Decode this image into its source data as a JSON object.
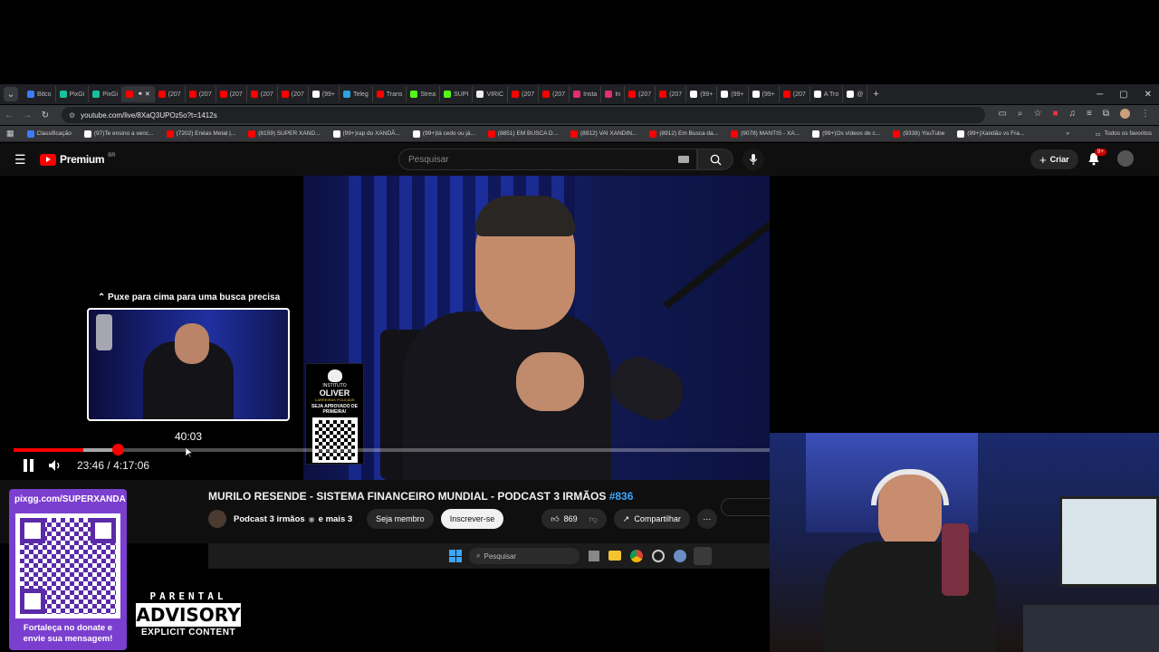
{
  "browser": {
    "tabs": [
      {
        "label": "Bitco",
        "color": "#3d7bfd"
      },
      {
        "label": "PixGi",
        "color": "#19c0a0"
      },
      {
        "label": "PixGi",
        "color": "#19c0a0"
      },
      {
        "label": "",
        "color": "#ff0000",
        "active": true
      },
      {
        "label": "(207",
        "color": "#ff0000"
      },
      {
        "label": "(207",
        "color": "#ff0000"
      },
      {
        "label": "(207",
        "color": "#ff0000"
      },
      {
        "label": "(207",
        "color": "#ff0000"
      },
      {
        "label": "(207",
        "color": "#ff0000"
      },
      {
        "label": "(99+",
        "color": "#ffffff"
      },
      {
        "label": "Teleg",
        "color": "#2aa3e0"
      },
      {
        "label": "Trans",
        "color": "#ff0000"
      },
      {
        "label": "Strea",
        "color": "#53fc18"
      },
      {
        "label": "SUPI",
        "color": "#53fc18"
      },
      {
        "label": "VIRIC",
        "color": "#eeeeee"
      },
      {
        "label": "(207",
        "color": "#ff0000"
      },
      {
        "label": "(207",
        "color": "#ff0000"
      },
      {
        "label": "Insta",
        "color": "#e1306c"
      },
      {
        "label": "In",
        "color": "#e1306c"
      },
      {
        "label": "(207",
        "color": "#ff0000"
      },
      {
        "label": "(207",
        "color": "#ff0000"
      },
      {
        "label": "(99+",
        "color": "#ffffff"
      },
      {
        "label": "(99+",
        "color": "#ffffff"
      },
      {
        "label": "(99+",
        "color": "#ffffff"
      },
      {
        "label": "(207",
        "color": "#ff0000"
      },
      {
        "label": "A Tro",
        "color": "#ffffff"
      },
      {
        "label": "@",
        "color": "#ffffff"
      }
    ],
    "url": "youtube.com/live/8XaQ3UPOz5o?t=1412s",
    "bookmarks": [
      {
        "label": "Classificação",
        "color": "#3d7bfd"
      },
      {
        "label": "(97)Te ensino a venc...",
        "color": "#ffffff"
      },
      {
        "label": "(7202) Enéas Metal |...",
        "color": "#ff0000"
      },
      {
        "label": "(8159) SUPER XAND...",
        "color": "#ff0000"
      },
      {
        "label": "(99+)rap do XANDÃ...",
        "color": "#ffffff"
      },
      {
        "label": "(99+)tá cedo ou já...",
        "color": "#ffffff"
      },
      {
        "label": "(8851) EM BUSCA D...",
        "color": "#ff0000"
      },
      {
        "label": "(8912) VAI XANDIN...",
        "color": "#ff0000"
      },
      {
        "label": "(8912) Em Busca da...",
        "color": "#ff0000"
      },
      {
        "label": "(9078) MANTIS - XA...",
        "color": "#ff0000"
      },
      {
        "label": "(99+)Os vídeos de c...",
        "color": "#ffffff"
      },
      {
        "label": "(9338) YouTube",
        "color": "#ff0000"
      },
      {
        "label": "(99+)Xandão vs Fra...",
        "color": "#ffffff"
      }
    ],
    "all_bookmarks": "Todos os favoritos"
  },
  "youtube": {
    "logo_text": "Premium",
    "logo_region": "BR",
    "search_placeholder": "Pesquisar",
    "create_label": "Criar",
    "notifications_badge": "9+"
  },
  "player": {
    "preview_hint": "Puxe para cima para uma busca precisa",
    "preview_time": "40:03",
    "current_time": "23:46",
    "separator": "/",
    "duration": "4:17:06",
    "progress_fraction": 0.0925,
    "buffer_fraction": 0.13,
    "sponsor_card": {
      "line1": "INSTITUTO",
      "line2": "OLIVER",
      "line3": "CARREIRAS POLICIAIS",
      "line4": "SEJA APROVADO DE",
      "line5": "PRIMEIRA!"
    }
  },
  "video": {
    "title": "MURILO RESENDE - SISTEMA FINANCEIRO MUNDIAL - PODCAST 3 IRMÃOS",
    "hashtag": "#836",
    "channel": "Podcast 3 irmãos",
    "channel_suffix": "e mais 3",
    "member_button": "Seja membro",
    "subscribe_button": "Inscrever-se",
    "likes": "869",
    "share_label": "Compartilhar"
  },
  "taskbar": {
    "search_placeholder": "Pesquisar"
  },
  "overlay": {
    "pix_url": "pixgg.com/SUPERXANDA",
    "pix_message_1": "Fortaleça no donate e",
    "pix_message_2": "envie sua mensagem!",
    "advisory_line1": "PARENTAL",
    "advisory_line2": "ADVISORY",
    "advisory_line3": "EXPLICIT CONTENT"
  }
}
